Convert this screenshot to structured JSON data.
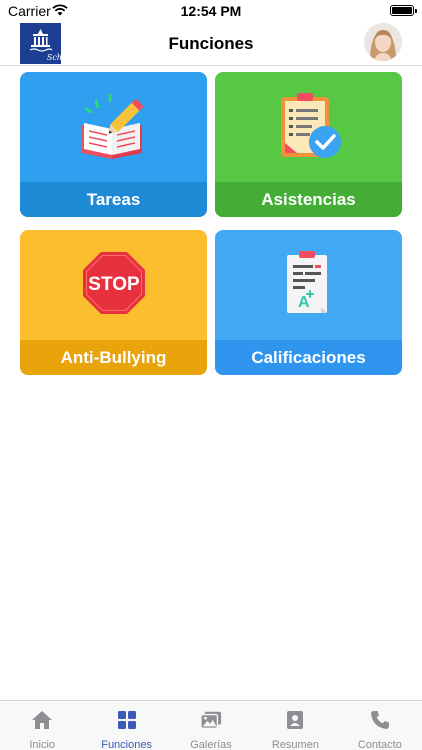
{
  "status_bar": {
    "carrier": "Carrier",
    "time": "12:54 PM"
  },
  "header": {
    "title": "Funciones",
    "logo_text": "School"
  },
  "tiles": [
    {
      "label": "Tareas",
      "icon": "homework-book-icon",
      "color": "#2fa0ef",
      "band_color": "#1e8ad6"
    },
    {
      "label": "Asistencias",
      "icon": "attendance-clipboard-icon",
      "color": "#57c843",
      "band_color": "#43ad35"
    },
    {
      "label": "Anti-Bullying",
      "icon": "stop-sign-icon",
      "color": "#fbbf2d",
      "band_color": "#e8a40a"
    },
    {
      "label": "Calificaciones",
      "icon": "grades-report-icon",
      "color": "#43a9f4",
      "band_color": "#2f95ee"
    }
  ],
  "stop_sign_text": "STOP",
  "grade_letter": "A",
  "tab_bar": {
    "active_color": "#3b5ab8",
    "inactive_color": "#8e8e93",
    "items": [
      {
        "label": "Inicio",
        "icon": "home-icon",
        "active": false
      },
      {
        "label": "Funciones",
        "icon": "grid-icon",
        "active": true
      },
      {
        "label": "Galerías",
        "icon": "gallery-icon",
        "active": false
      },
      {
        "label": "Resumen",
        "icon": "profile-card-icon",
        "active": false
      },
      {
        "label": "Contacto",
        "icon": "phone-icon",
        "active": false
      }
    ]
  }
}
